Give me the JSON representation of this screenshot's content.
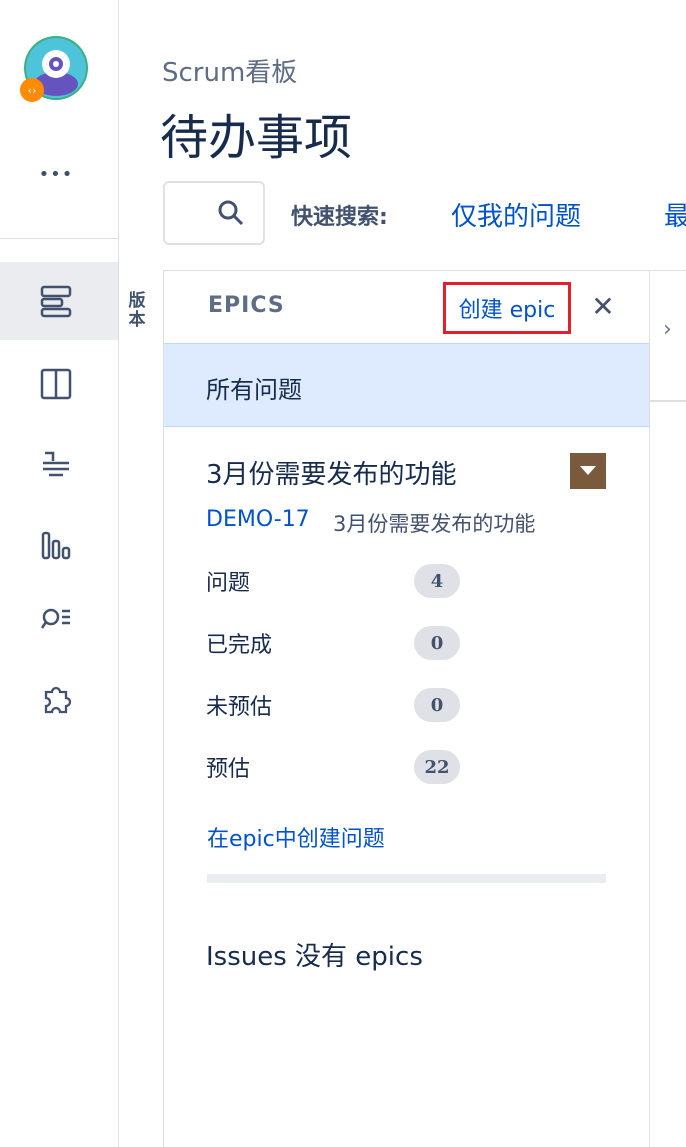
{
  "app": {
    "rail_icons": [
      "app-logo-icon",
      "more-icon",
      "backlog-icon",
      "board-icon",
      "releases-icon",
      "reports-icon",
      "issues-search-icon",
      "addons-icon"
    ],
    "more_label": "•••"
  },
  "sidebar": {
    "vertical_label": "版本"
  },
  "header": {
    "breadcrumb": "Scrum看板",
    "title": "待办事项",
    "quick_search_label": "快速搜索:",
    "quick_filters": [
      "仅我的问题",
      "最"
    ]
  },
  "epics_panel": {
    "title": "EPICS",
    "create_epic": "创建 epic",
    "close_glyph": "✕",
    "all_issues": "所有问题",
    "epic": {
      "name": "3月份需要发布的功能",
      "key": "DEMO-17",
      "summary": "3月份需要发布的功能",
      "stats": [
        {
          "label": "问题",
          "value": "4"
        },
        {
          "label": "已完成",
          "value": "0"
        },
        {
          "label": "未预估",
          "value": "0"
        },
        {
          "label": "预估",
          "value": "22"
        }
      ],
      "create_issue_link": "在epic中创建问题"
    },
    "no_epics_text": "Issues 没有 epics"
  },
  "colors": {
    "link": "#0052cc",
    "selected_bg": "#deebff",
    "epic_color": "#7a5a3c",
    "highlight_border": "#e0212b"
  }
}
